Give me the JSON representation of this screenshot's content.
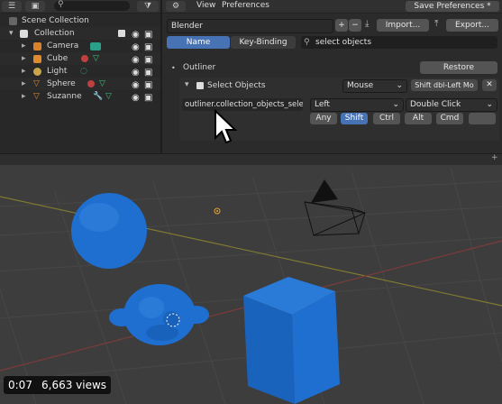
{
  "outliner": {
    "title": "Scene Collection",
    "collection": "Collection",
    "objects": [
      {
        "name": "Camera"
      },
      {
        "name": "Cube"
      },
      {
        "name": "Light"
      },
      {
        "name": "Sphere"
      },
      {
        "name": "Suzanne"
      }
    ]
  },
  "prefs": {
    "menus": {
      "view": "View",
      "preferences": "Preferences"
    },
    "save_button": "Save Preferences *",
    "keymap_preset": "Blender",
    "import_button": "Import...",
    "export_button": "Export...",
    "tabs": {
      "name": "Name",
      "key_binding": "Key-Binding"
    },
    "search_value": "select objects",
    "section": "Outliner",
    "restore_button": "Restore",
    "item_label": "Select Objects",
    "input_type": "Mouse",
    "binding_summary": "Shift dbl-Left Mo",
    "operator_id": "outliner.collection_objects_select",
    "mouse_button": "Left",
    "click_type": "Double Click",
    "modifiers": [
      "Any",
      "Shift",
      "Ctrl",
      "Alt",
      "Cmd"
    ],
    "active_modifier": "Shift"
  },
  "video": {
    "time": "0:07",
    "views": "6,663 views"
  },
  "colors": {
    "accent": "#4772b3",
    "object": "#1f6fd0",
    "background": "#3d3d3d"
  }
}
